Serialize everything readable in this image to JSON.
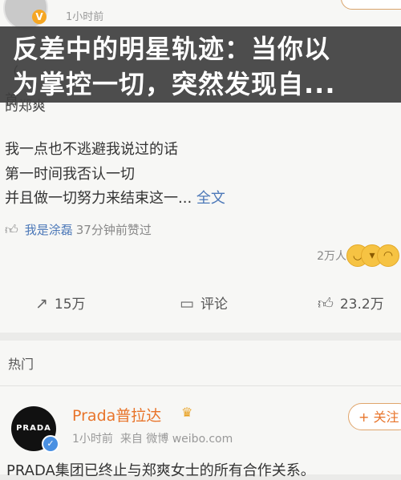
{
  "banner": {
    "line1": "反差中的明星轨迹：当你以",
    "line2": "为掌控一切，突然发现自..."
  },
  "prev_post": {
    "time": "1小时前",
    "partial_text_1": "（",
    "partial_text_2": "首",
    "partial_text_3": "有旧",
    "partial_text_4": "的郑爽"
  },
  "post": {
    "lines": [
      "我一点也不逃避我说过的话",
      "第一时间我否认一切",
      "并且做一切努力来结束这一..."
    ],
    "full_text_link": "全文",
    "liker_name": "我是涂磊",
    "liker_time": "37分钟前赞过",
    "reaction_count": "2万人",
    "reposts": "15万",
    "comments_label": "评论",
    "likes": "23.2万"
  },
  "hot": {
    "label": "热门",
    "author": "Prada普拉达",
    "logo_text": "PRADA",
    "time": "1小时前",
    "source": "来自 微博 weibo.com",
    "follow_label": "+ 关注",
    "text": "PRADA集团已终止与郑爽女士的所有合作关系。"
  },
  "colors": {
    "link": "#4c78b8",
    "accent_orange": "#e8742a",
    "verified_blue": "#4a90e2"
  }
}
